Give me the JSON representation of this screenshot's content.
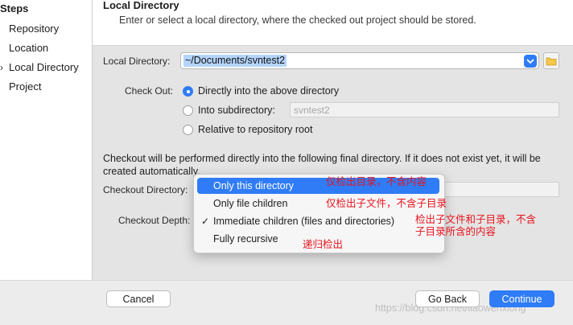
{
  "sidebar": {
    "title": "Steps",
    "items": [
      {
        "label": "Repository",
        "current": false
      },
      {
        "label": "Location",
        "current": false
      },
      {
        "label": "Local Directory",
        "current": true
      },
      {
        "label": "Project",
        "current": false
      }
    ]
  },
  "header": {
    "title": "Local Directory",
    "subtitle": "Enter or select a local directory, where the checked out project should be stored."
  },
  "local_directory": {
    "label": "Local Directory:",
    "value": "~/Documents/svntest2"
  },
  "checkout": {
    "label": "Check Out:",
    "options": [
      {
        "label": "Directly into the above directory",
        "selected": true
      },
      {
        "label": "Into subdirectory:",
        "selected": false
      },
      {
        "label": "Relative to repository root",
        "selected": false
      }
    ],
    "subdirectory_placeholder": "svntest2"
  },
  "info_text": "Checkout will be performed directly into the following final directory. If it does not exist yet, it will be created automatically.",
  "checkout_directory": {
    "label": "Checkout Directory:"
  },
  "checkout_depth": {
    "label": "Checkout Depth:",
    "options": [
      {
        "label": "Only this directory",
        "highlighted": true,
        "checked": false
      },
      {
        "label": "Only file children",
        "highlighted": false,
        "checked": false
      },
      {
        "label": "Immediate children (files and directories)",
        "highlighted": false,
        "checked": true
      },
      {
        "label": "Fully recursive",
        "highlighted": false,
        "checked": false
      }
    ]
  },
  "annotations": [
    "仅检出目录，不含内容",
    "仅检出子文件，不含子目录",
    "检出子文件和子目录，不含",
    "子目录所含的内容",
    "递归检出"
  ],
  "footer": {
    "cancel_label": "Cancel",
    "back_label": "Go Back",
    "continue_label": "Continue"
  },
  "watermark": "https://blog.csdn.net/liaowenxiong",
  "colors": {
    "accent": "#2f7cf6",
    "annotation": "#e8121d",
    "highlight": "#b4d4fb"
  },
  "icons": {
    "folder": "folder-icon",
    "dropdown": "chevron-down-icon",
    "check": "checkmark-icon",
    "arrow": "chevron-right-icon"
  }
}
